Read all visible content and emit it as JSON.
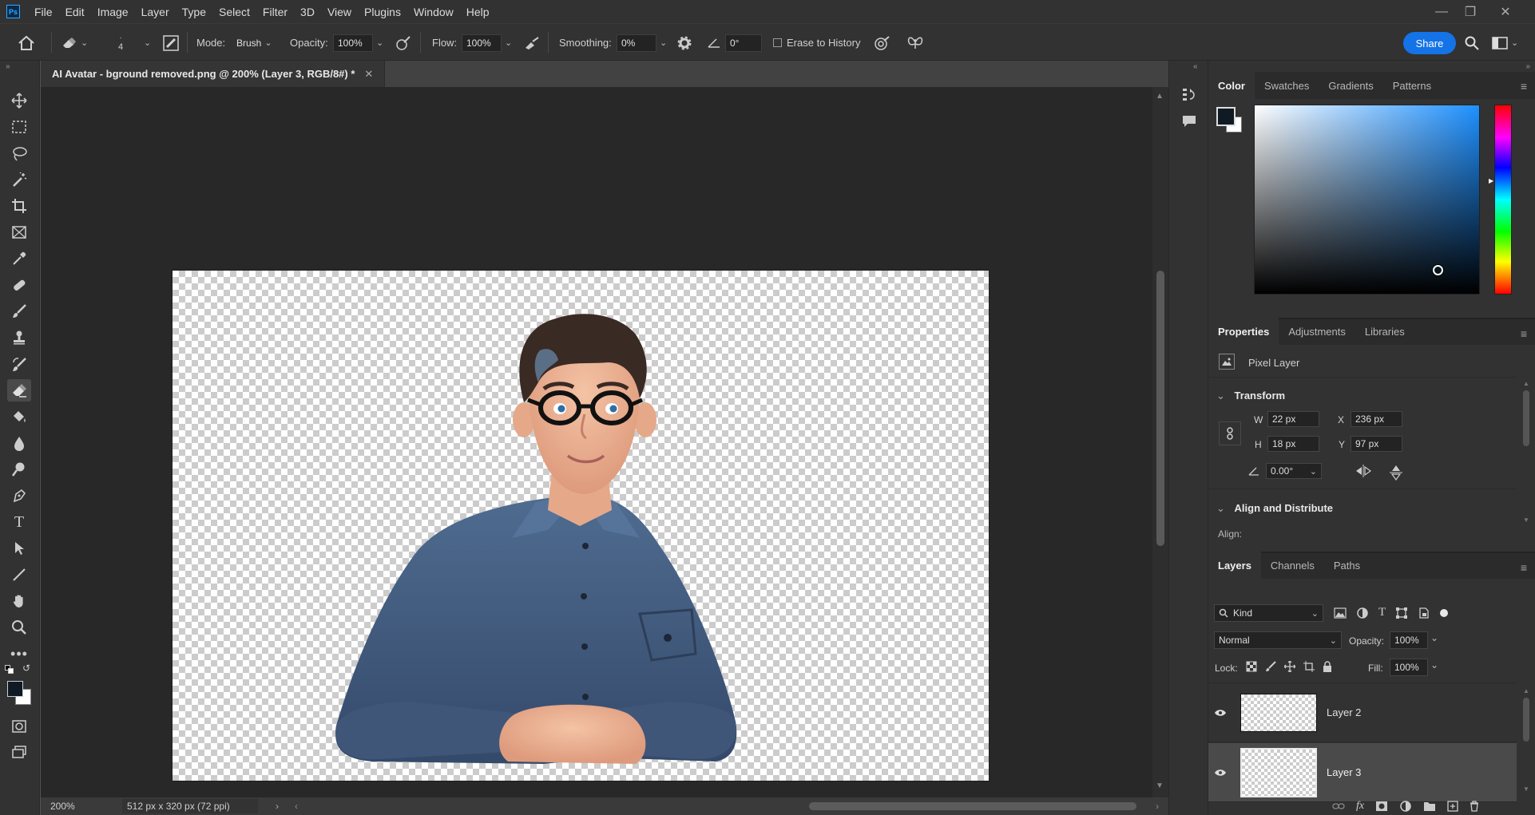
{
  "app": {
    "logo": "Ps"
  },
  "menu": [
    "File",
    "Edit",
    "Image",
    "Layer",
    "Type",
    "Select",
    "Filter",
    "3D",
    "View",
    "Plugins",
    "Window",
    "Help"
  ],
  "options": {
    "brush_size": "4",
    "mode_label": "Mode:",
    "mode_value": "Brush",
    "opacity_label": "Opacity:",
    "opacity_value": "100%",
    "flow_label": "Flow:",
    "flow_value": "100%",
    "smoothing_label": "Smoothing:",
    "smoothing_value": "0%",
    "angle_value": "0°",
    "erase_history_label": "Erase to History",
    "share_label": "Share"
  },
  "document": {
    "tab_title": "AI Avatar - bground removed.png @ 200% (Layer 3, RGB/8#) *",
    "zoom": "200%",
    "doc_info": "512 px x 320 px (72 ppi)"
  },
  "color_panel": {
    "tabs": [
      "Color",
      "Swatches",
      "Gradients",
      "Patterns"
    ],
    "foreground": "#0f1a24",
    "background": "#ffffff",
    "hue_color": "#1e90ff"
  },
  "properties_panel": {
    "tabs": [
      "Properties",
      "Adjustments",
      "Libraries"
    ],
    "kind": "Pixel Layer",
    "transform_title": "Transform",
    "w_label": "W",
    "w_value": "22 px",
    "h_label": "H",
    "h_value": "18 px",
    "x_label": "X",
    "x_value": "236 px",
    "y_label": "Y",
    "y_value": "97 px",
    "angle_value": "0.00°",
    "align_title": "Align and Distribute",
    "align_label": "Align:"
  },
  "layers_panel": {
    "tabs": [
      "Layers",
      "Channels",
      "Paths"
    ],
    "filter_kind": "Kind",
    "blend_mode": "Normal",
    "opacity_label": "Opacity:",
    "opacity_value": "100%",
    "lock_label": "Lock:",
    "fill_label": "Fill:",
    "fill_value": "100%",
    "layers": [
      {
        "name": "Layer 2",
        "selected": false
      },
      {
        "name": "Layer 3",
        "selected": true
      }
    ]
  }
}
